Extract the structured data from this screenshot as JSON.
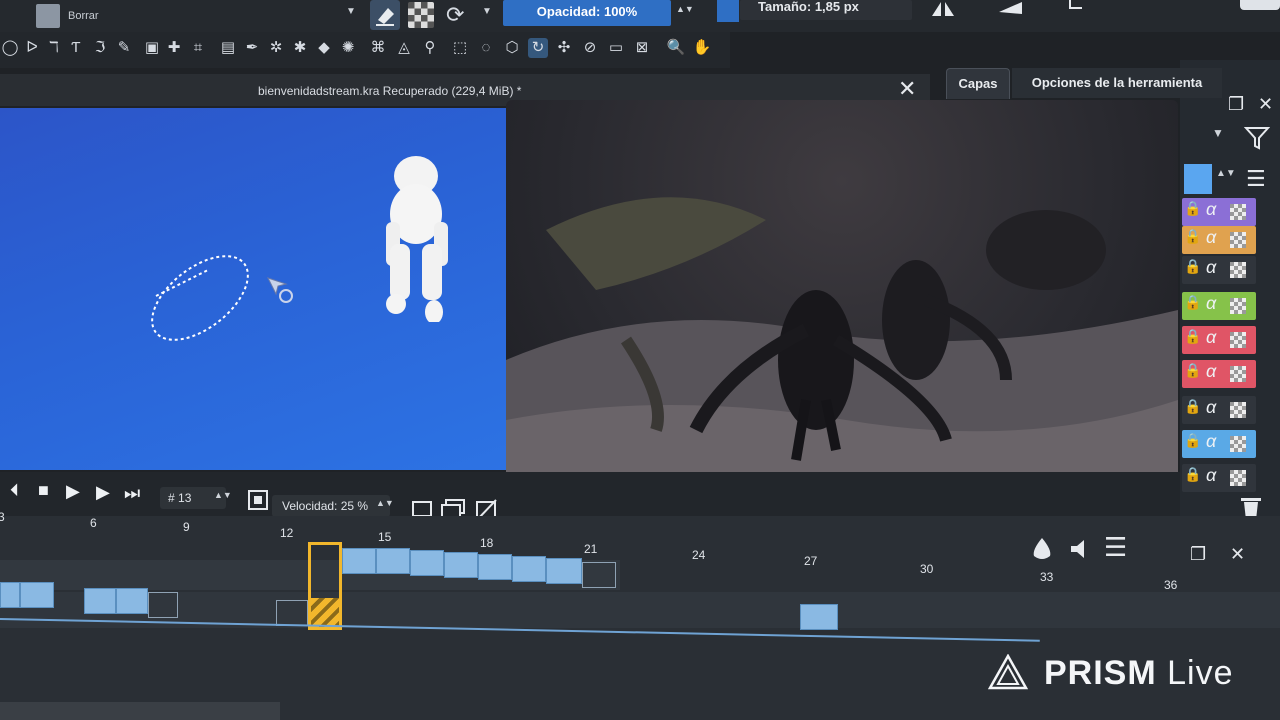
{
  "toolbar": {
    "brush_name": "Borrar",
    "opacity_label": "Opacidad: 100%",
    "size_label": "Tamaño: 1,85 px"
  },
  "document": {
    "title": "bienvenidadstream.kra Recuperado (229,4 MiB) *",
    "close_glyph": "✕"
  },
  "docker": {
    "tab_layers": "Capas",
    "tab_tool_options": "Opciones de la herramienta",
    "layer_colors": [
      "#8b6fd6",
      "#e0a24f",
      "#30353c",
      "#86c24a",
      "#e05566",
      "#e05566",
      "#30353c",
      "#5aa9e6",
      "#30353c"
    ]
  },
  "transport": {
    "frame_value": "13",
    "speed_label": "Velocidad: 25 %"
  },
  "timeline": {
    "ruler": [
      "3",
      "6",
      "9",
      "12",
      "15",
      "18",
      "21",
      "24",
      "27",
      "30",
      "33",
      "36"
    ]
  },
  "watermark": {
    "brand": "PRISM",
    "suffix": "Live"
  },
  "icons": {
    "tools": [
      "ellipse-select-icon",
      "polyline-icon",
      "measure-icon",
      "text-icon",
      "calligraphy-icon",
      "dynamic-brush-icon",
      "rect-icon",
      "move-icon",
      "crop-icon",
      "gradient-icon",
      "color-picker-icon",
      "smart-patch-icon",
      "fill-icon",
      "pattern-icon",
      "transform-icon",
      "assistant-icon",
      "reference-icon",
      "rect-select-icon",
      "ellipse-sel-icon",
      "polygon-select-icon",
      "freehand-select-icon",
      "contiguous-select-icon",
      "similar-select-icon",
      "bezier-select-icon",
      "magnetic-select-icon",
      "zoom-icon",
      "pan-icon"
    ]
  }
}
